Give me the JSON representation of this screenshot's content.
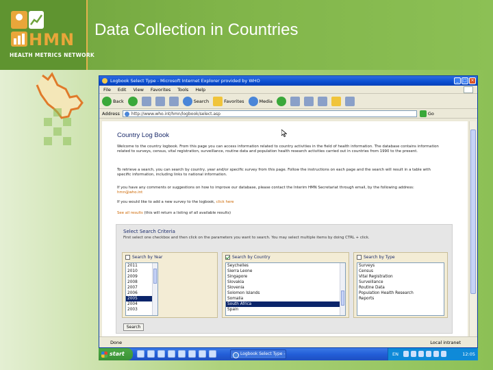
{
  "slide": {
    "title": "Data Collection in Countries",
    "logo": {
      "name": "HMN",
      "subtitle": "HEALTH METRICS NETWORK"
    }
  },
  "browser": {
    "window_title": "Logbook Select Type - Microsoft Internet Explorer provided by WHO",
    "menu": [
      "File",
      "Edit",
      "View",
      "Favorites",
      "Tools",
      "Help"
    ],
    "toolbar": {
      "back": "Back",
      "search": "Search",
      "favorites": "Favorites",
      "media": "Media"
    },
    "address_label": "Address",
    "address_value": "http://www.who.int/hmn/logbook/select.asp",
    "go_label": "Go",
    "status_text": "Done",
    "status_zone": "Local intranet"
  },
  "page": {
    "heading": "Country Log Book",
    "intro": "Welcome to the country logbook. From this page you can access information related to country activities in the field of health information. The database contains information related to surveys, census, vital registration, surveillance, routine data and population health research activities carried out in countries from 1990 to the present.",
    "search_help": "To retrieve a search, you can search by country, year and/or specific survey from this page. Follow the instructions on each page and the search will result in a table with specific information, including links to national information.",
    "contact_text": "If you have any comments or suggestions on how to improve our database, please contact the Interim HMN Secretariat through email, by the following address:",
    "contact_link": "hmn@who.int",
    "add_text": "If you would like to add a new survey to the logbook, ",
    "add_link": "click here",
    "see_all_link": "See all results",
    "see_all_text": " (this will return a listing of all available results)",
    "criteria": {
      "title": "Select Search Criteria",
      "instructions": "First select one checkbox and then click on the parameters you want to search. You may select multiple items by doing CTRL + click."
    },
    "year_panel": {
      "label": "Search by Year",
      "items": [
        "2011",
        "2010",
        "2009",
        "2008",
        "2007",
        "2006",
        "2005",
        "2004",
        "2003"
      ],
      "selected_index": 6
    },
    "country_panel": {
      "label": "Search by Country",
      "items": [
        "Seychelles",
        "Sierra Leone",
        "Singapore",
        "Slovakia",
        "Slovenia",
        "Solomon Islands",
        "Somalia",
        "South Africa",
        "Spain"
      ],
      "selected_index": 7
    },
    "type_panel": {
      "label": "Search by Type",
      "items": [
        "Surveys",
        "Census",
        "Vital Registration",
        "Surveillance",
        "Routine Data",
        "Population Health Research",
        "Reports"
      ]
    },
    "search_button": "Search"
  },
  "taskbar": {
    "start_label": "start",
    "task_label": "Logbook Select Type -",
    "tray_lang": "EN",
    "clock": "12:05"
  }
}
